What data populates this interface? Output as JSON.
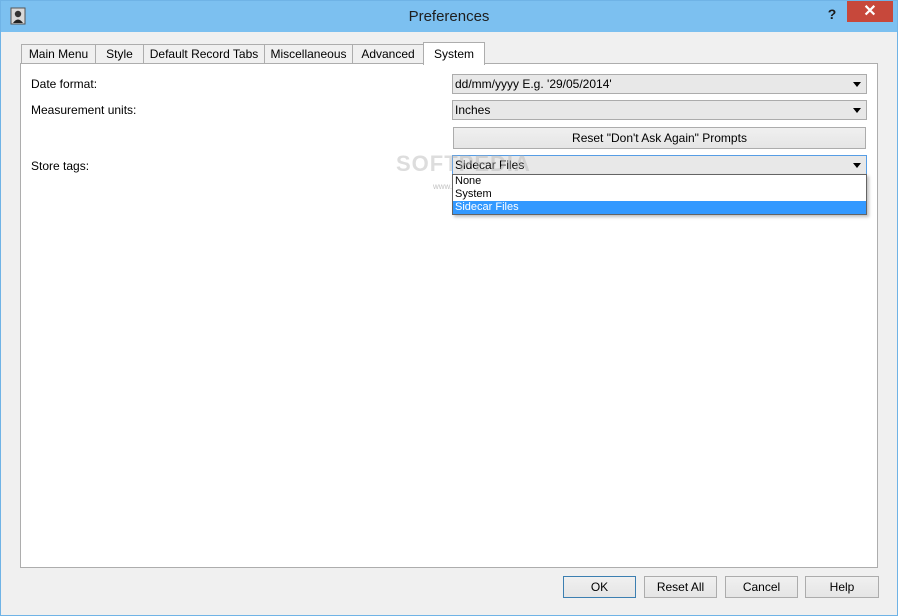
{
  "window": {
    "title": "Preferences",
    "help_label": "?",
    "close_label": "✕"
  },
  "tabs": [
    {
      "label": "Main Menu"
    },
    {
      "label": "Style"
    },
    {
      "label": "Default Record Tabs"
    },
    {
      "label": "Miscellaneous"
    },
    {
      "label": "Advanced"
    },
    {
      "label": "System",
      "active": true
    }
  ],
  "system": {
    "date_format_label": "Date format:",
    "date_format_value": "dd/mm/yyyy E.g. '29/05/2014'",
    "measurement_units_label": "Measurement units:",
    "measurement_units_value": "Inches",
    "reset_prompts_label": "Reset \"Don't Ask Again\" Prompts",
    "store_tags_label": "Store tags:",
    "store_tags_value": "Sidecar Files",
    "store_tags_options": [
      "None",
      "System",
      "Sidecar Files"
    ],
    "store_tags_selected_index": 2
  },
  "footer": {
    "ok_label": "OK",
    "reset_all_label": "Reset All",
    "cancel_label": "Cancel",
    "help_label": "Help"
  },
  "watermark": {
    "text": "SOFTPEDIA",
    "url": "www.softpedia.com"
  },
  "colors": {
    "titlebar": "#7cc0f0",
    "close_button": "#c7483b",
    "selection": "#3399ff",
    "default_button_border": "#3c7fb1"
  }
}
